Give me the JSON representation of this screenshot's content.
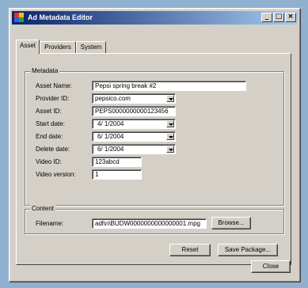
{
  "window": {
    "title": "Ad Metadata Editor"
  },
  "titlebar_buttons": {
    "minimize": "_",
    "maximize": "□",
    "close": "×"
  },
  "tabs": [
    {
      "label": "Asset",
      "active": true
    },
    {
      "label": "Providers",
      "active": false
    },
    {
      "label": "System",
      "active": false
    }
  ],
  "metadata": {
    "legend": "Metadata",
    "asset_name_label": "Asset Name:",
    "asset_name_value": "Pepsi spring break #2",
    "provider_id_label": "Provider ID:",
    "provider_id_value": "pepsico.com",
    "asset_id_label": "Asset ID:",
    "asset_id_value": "PEPS0000000000123456",
    "start_date_label": "Start date:",
    "start_date_value": "4/ 1/2004",
    "end_date_label": "End date:",
    "end_date_value": "6/ 1/2004",
    "delete_date_label": "Delete date:",
    "delete_date_value": "6/ 1/2004",
    "video_id_label": "Video ID:",
    "video_id_value": "123abcd",
    "video_version_label": "Video version:",
    "video_version_value": "1"
  },
  "content": {
    "legend": "Content",
    "filename_label": "Filename:",
    "filename_value": "adl\\n\\BUDW0000000000000001.mpg",
    "browse_label": "Browse..."
  },
  "actions": {
    "reset_label": "Reset",
    "save_label": "Save Package...",
    "close_label": "Close"
  },
  "colors": {
    "desktop": "#8fb1cf",
    "titlebar_start": "#0a246a",
    "titlebar_end": "#a6caf0",
    "face": "#d4d0c8"
  }
}
